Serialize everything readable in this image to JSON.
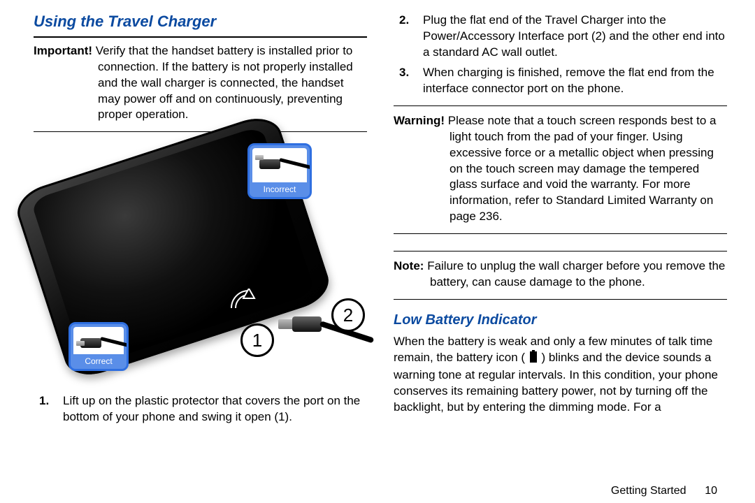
{
  "left": {
    "heading": "Using the Travel Charger",
    "important_label": "Important!",
    "important_text": "Verify that the handset battery is installed prior to connection. If the battery is not properly installed and the wall charger is connected, the handset may power off and on continuously, preventing proper operation.",
    "badge_incorrect": "Incorrect",
    "badge_correct": "Correct",
    "callout_1": "1",
    "callout_2": "2",
    "step1_num": "1.",
    "step1_text": "Lift up on the plastic protector that covers the port on the bottom of your phone and swing it open (1)."
  },
  "right": {
    "step2_num": "2.",
    "step2_text": "Plug the flat end of the Travel Charger into the Power/Accessory Interface port (2) and the other end into a standard AC wall outlet.",
    "step3_num": "3.",
    "step3_text": "When charging is finished, remove the flat end from the interface connector port on the phone.",
    "warning_label": "Warning!",
    "warning_text_a": "Please note that a touch screen responds best to a light touch from the pad of your finger. Using excessive force or a metallic object when pressing on the touch screen may damage the tempered glass surface and void the warranty. For more information, refer to ",
    "warning_xref": "Standard Limited Warranty",
    "warning_text_b": " on page 236.",
    "note_label": "Note:",
    "note_text": "Failure to unplug the wall charger before you remove the battery, can cause damage to the phone.",
    "heading2": "Low Battery Indicator",
    "lbi_a": "When the battery is weak and only a few minutes of talk time remain, the battery icon (",
    "lbi_b": ") blinks and the device sounds a warning tone at regular intervals. In this condition, your phone conserves its remaining battery power, not by turning off the backlight, but by entering the dimming mode. For a"
  },
  "footer": {
    "section": "Getting Started",
    "page": "10"
  }
}
